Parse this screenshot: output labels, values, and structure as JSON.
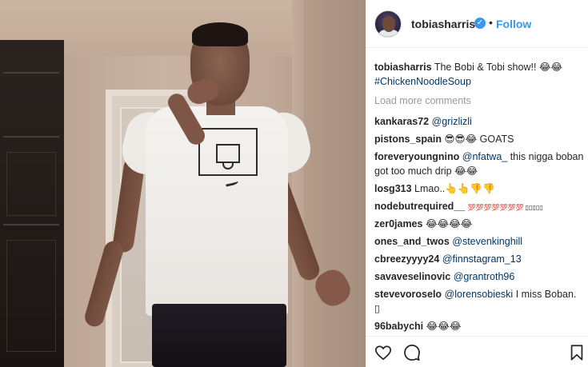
{
  "post": {
    "username": "tobiasharris",
    "verified_mark": "✓",
    "separator": "•",
    "follow_label": "Follow",
    "caption_text": "The Bobi & Tobi show!! 😂😂",
    "caption_hashtag": "#ChickenNoodleSoup",
    "load_more_label": "Load more comments"
  },
  "comments": [
    {
      "user": "kankaras72",
      "mention": "@grizlizli",
      "text": ""
    },
    {
      "user": "pistons_spain",
      "mention": "",
      "text": "😎😎😂 GOATS"
    },
    {
      "user": "foreveryoungnino",
      "mention": "@nfatwa_",
      "text": " this nigga boban got too much drip 😂😂"
    },
    {
      "user": "losg313",
      "mention": "",
      "text": "Lmao..👆👆👎👎"
    },
    {
      "user": "nodebutrequired__",
      "mention": "",
      "text": "💯💯💯💯💯💯💯 ▯▯▯▯▯"
    },
    {
      "user": "zer0james",
      "mention": "",
      "text": "😂😂😂😂"
    },
    {
      "user": "ones_and_twos",
      "mention": "@stevenkinghill",
      "text": ""
    },
    {
      "user": "cbreezyyyy24",
      "mention": "@finnstagram_13",
      "text": ""
    },
    {
      "user": "savaveselinovic",
      "mention": "@grantroth96",
      "text": ""
    },
    {
      "user": "stevevoroselo",
      "mention": "@lorensobieski",
      "text": " I miss Boban. ▯"
    },
    {
      "user": "96babychi",
      "mention": "",
      "text": "😂😂😂"
    }
  ],
  "icons": {
    "like": "heart-icon",
    "comment": "comment-icon",
    "save": "bookmark-icon"
  },
  "colors": {
    "link_blue": "#3897f0",
    "mention_blue": "#003569",
    "muted_gray": "#999999",
    "text": "#262626"
  }
}
